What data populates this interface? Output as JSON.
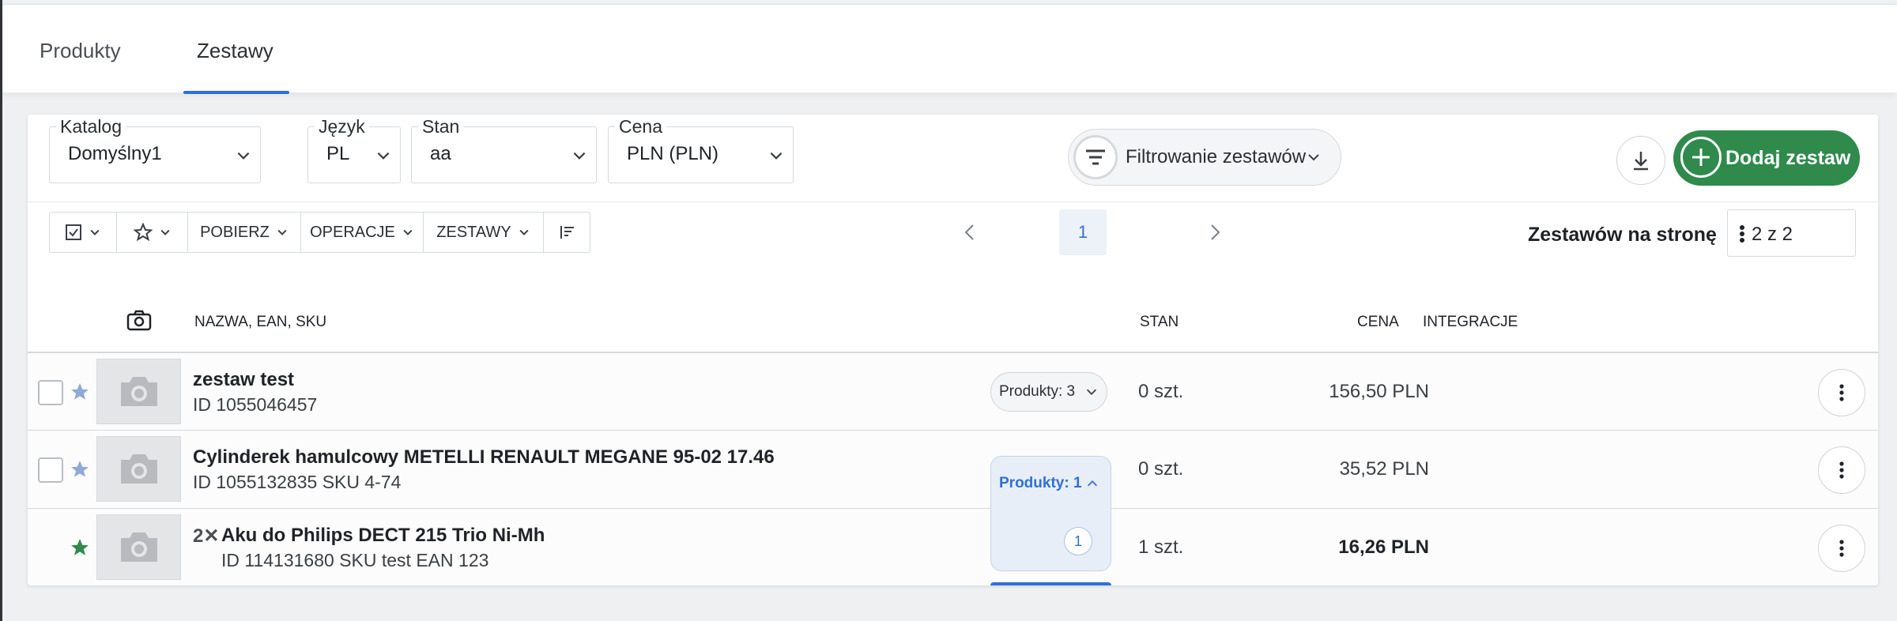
{
  "tabs": [
    {
      "label": "Produkty",
      "active": false
    },
    {
      "label": "Zestawy",
      "active": true
    }
  ],
  "filters": {
    "katalog": {
      "label": "Katalog",
      "value": "Domyślny1"
    },
    "jezyk": {
      "label": "Język",
      "value": "PL"
    },
    "stan": {
      "label": "Stan",
      "value": "aa"
    },
    "cena": {
      "label": "Cena",
      "value": "PLN (PLN)"
    }
  },
  "filter_button": {
    "label": "Filtrowanie zestawów",
    "icon": "filter-icon"
  },
  "actions": {
    "download_icon": "download-icon",
    "add_label": "Dodaj zestaw",
    "add_color": "#2f8a4b"
  },
  "toolbar": {
    "pobierz": "POBIERZ",
    "operacje": "OPERACJE",
    "zestawy": "ZESTAWY"
  },
  "pagination": {
    "current_page": "1",
    "per_page_label": "Zestawów na stronę",
    "per_page_value": "2 z 2"
  },
  "columns": {
    "name": "NAZWA, EAN, SKU",
    "stan": "STAN",
    "cena": "CENA",
    "integracje": "INTEGRACJE"
  },
  "rows": [
    {
      "name": "zestaw test",
      "meta": "ID 1055046457",
      "products": "Produkty: 3",
      "stan": "0 szt.",
      "cena": "156,50 PLN",
      "starred": false
    },
    {
      "name": "Cylinderek hamulcowy METELLI RENAULT MEGANE 95-02 17.46",
      "meta": "ID 1055132835 SKU 4-74",
      "products": "Produkty: 1",
      "stan": "0 szt.",
      "cena": "35,52 PLN",
      "starred": false
    },
    {
      "qty_prefix": "2✕",
      "name": "Aku do Philips DECT 215 Trio Ni-Mh",
      "meta": "ID 114131680 SKU test EAN 123",
      "stan": "1 szt.",
      "cena": "16,26 PLN",
      "starred": true,
      "badge": "1"
    }
  ],
  "colors": {
    "accent": "#2f6fd7",
    "star_inactive": "#8fa9d8",
    "star_active": "#2f8a4b"
  }
}
